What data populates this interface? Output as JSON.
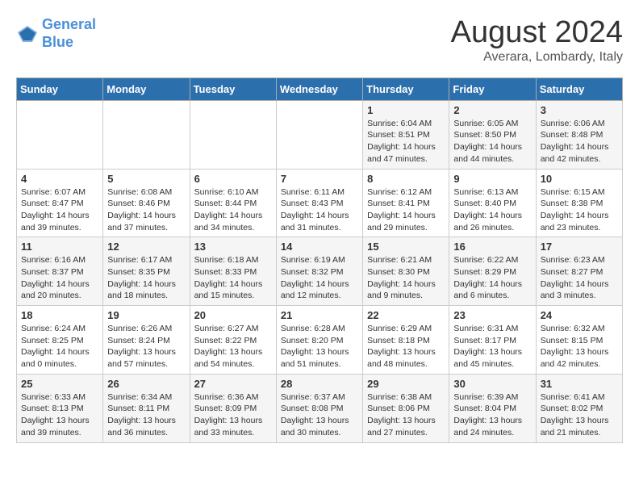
{
  "logo": {
    "line1": "General",
    "line2": "Blue"
  },
  "title": "August 2024",
  "subtitle": "Averara, Lombardy, Italy",
  "weekdays": [
    "Sunday",
    "Monday",
    "Tuesday",
    "Wednesday",
    "Thursday",
    "Friday",
    "Saturday"
  ],
  "weeks": [
    [
      {
        "day": "",
        "info": ""
      },
      {
        "day": "",
        "info": ""
      },
      {
        "day": "",
        "info": ""
      },
      {
        "day": "",
        "info": ""
      },
      {
        "day": "1",
        "info": "Sunrise: 6:04 AM\nSunset: 8:51 PM\nDaylight: 14 hours\nand 47 minutes."
      },
      {
        "day": "2",
        "info": "Sunrise: 6:05 AM\nSunset: 8:50 PM\nDaylight: 14 hours\nand 44 minutes."
      },
      {
        "day": "3",
        "info": "Sunrise: 6:06 AM\nSunset: 8:48 PM\nDaylight: 14 hours\nand 42 minutes."
      }
    ],
    [
      {
        "day": "4",
        "info": "Sunrise: 6:07 AM\nSunset: 8:47 PM\nDaylight: 14 hours\nand 39 minutes."
      },
      {
        "day": "5",
        "info": "Sunrise: 6:08 AM\nSunset: 8:46 PM\nDaylight: 14 hours\nand 37 minutes."
      },
      {
        "day": "6",
        "info": "Sunrise: 6:10 AM\nSunset: 8:44 PM\nDaylight: 14 hours\nand 34 minutes."
      },
      {
        "day": "7",
        "info": "Sunrise: 6:11 AM\nSunset: 8:43 PM\nDaylight: 14 hours\nand 31 minutes."
      },
      {
        "day": "8",
        "info": "Sunrise: 6:12 AM\nSunset: 8:41 PM\nDaylight: 14 hours\nand 29 minutes."
      },
      {
        "day": "9",
        "info": "Sunrise: 6:13 AM\nSunset: 8:40 PM\nDaylight: 14 hours\nand 26 minutes."
      },
      {
        "day": "10",
        "info": "Sunrise: 6:15 AM\nSunset: 8:38 PM\nDaylight: 14 hours\nand 23 minutes."
      }
    ],
    [
      {
        "day": "11",
        "info": "Sunrise: 6:16 AM\nSunset: 8:37 PM\nDaylight: 14 hours\nand 20 minutes."
      },
      {
        "day": "12",
        "info": "Sunrise: 6:17 AM\nSunset: 8:35 PM\nDaylight: 14 hours\nand 18 minutes."
      },
      {
        "day": "13",
        "info": "Sunrise: 6:18 AM\nSunset: 8:33 PM\nDaylight: 14 hours\nand 15 minutes."
      },
      {
        "day": "14",
        "info": "Sunrise: 6:19 AM\nSunset: 8:32 PM\nDaylight: 14 hours\nand 12 minutes."
      },
      {
        "day": "15",
        "info": "Sunrise: 6:21 AM\nSunset: 8:30 PM\nDaylight: 14 hours\nand 9 minutes."
      },
      {
        "day": "16",
        "info": "Sunrise: 6:22 AM\nSunset: 8:29 PM\nDaylight: 14 hours\nand 6 minutes."
      },
      {
        "day": "17",
        "info": "Sunrise: 6:23 AM\nSunset: 8:27 PM\nDaylight: 14 hours\nand 3 minutes."
      }
    ],
    [
      {
        "day": "18",
        "info": "Sunrise: 6:24 AM\nSunset: 8:25 PM\nDaylight: 14 hours\nand 0 minutes."
      },
      {
        "day": "19",
        "info": "Sunrise: 6:26 AM\nSunset: 8:24 PM\nDaylight: 13 hours\nand 57 minutes."
      },
      {
        "day": "20",
        "info": "Sunrise: 6:27 AM\nSunset: 8:22 PM\nDaylight: 13 hours\nand 54 minutes."
      },
      {
        "day": "21",
        "info": "Sunrise: 6:28 AM\nSunset: 8:20 PM\nDaylight: 13 hours\nand 51 minutes."
      },
      {
        "day": "22",
        "info": "Sunrise: 6:29 AM\nSunset: 8:18 PM\nDaylight: 13 hours\nand 48 minutes."
      },
      {
        "day": "23",
        "info": "Sunrise: 6:31 AM\nSunset: 8:17 PM\nDaylight: 13 hours\nand 45 minutes."
      },
      {
        "day": "24",
        "info": "Sunrise: 6:32 AM\nSunset: 8:15 PM\nDaylight: 13 hours\nand 42 minutes."
      }
    ],
    [
      {
        "day": "25",
        "info": "Sunrise: 6:33 AM\nSunset: 8:13 PM\nDaylight: 13 hours\nand 39 minutes."
      },
      {
        "day": "26",
        "info": "Sunrise: 6:34 AM\nSunset: 8:11 PM\nDaylight: 13 hours\nand 36 minutes."
      },
      {
        "day": "27",
        "info": "Sunrise: 6:36 AM\nSunset: 8:09 PM\nDaylight: 13 hours\nand 33 minutes."
      },
      {
        "day": "28",
        "info": "Sunrise: 6:37 AM\nSunset: 8:08 PM\nDaylight: 13 hours\nand 30 minutes."
      },
      {
        "day": "29",
        "info": "Sunrise: 6:38 AM\nSunset: 8:06 PM\nDaylight: 13 hours\nand 27 minutes."
      },
      {
        "day": "30",
        "info": "Sunrise: 6:39 AM\nSunset: 8:04 PM\nDaylight: 13 hours\nand 24 minutes."
      },
      {
        "day": "31",
        "info": "Sunrise: 6:41 AM\nSunset: 8:02 PM\nDaylight: 13 hours\nand 21 minutes."
      }
    ]
  ]
}
